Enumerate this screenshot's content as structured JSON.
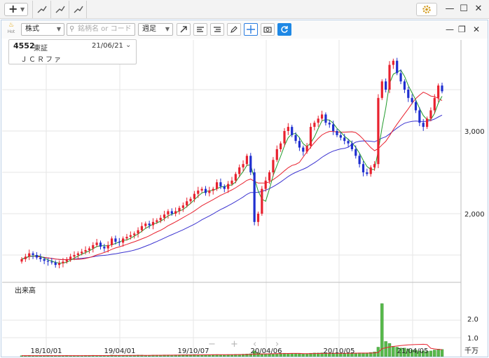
{
  "panel": {
    "market_select": "株式",
    "search_placeholder": "銘柄名 or コード",
    "period_select": "週足"
  },
  "info": {
    "code": "4552",
    "market": "東証",
    "date": "21/06/21",
    "name": "ＪＣＲファ"
  },
  "chart_data": {
    "type": "candlestick",
    "subtype": "weekly",
    "y_ticks": [
      "3,000",
      "2,000"
    ],
    "y_tick_values": [
      3000,
      2000
    ],
    "x_ticks": [
      "18/10/01",
      "19/04/01",
      "19/10/07",
      "20/04/06",
      "20/10/05",
      "21/04/05"
    ],
    "volume_label": "出来高",
    "volume_ticks": [
      "2.0",
      "1.0"
    ],
    "volume_tick_values": [
      2.0,
      1.0
    ],
    "volume_unit": "千万",
    "colors": {
      "up": "#e8212e",
      "down": "#1f2fd0",
      "ma_short": "#1f9a2a",
      "ma_mid": "#e8212e",
      "ma_long": "#3a32d0",
      "volume": "#57b94b"
    },
    "closes": [
      1450,
      1480,
      1520,
      1500,
      1470,
      1450,
      1430,
      1420,
      1410,
      1380,
      1400,
      1420,
      1450,
      1480,
      1500,
      1520,
      1540,
      1560,
      1580,
      1620,
      1650,
      1600,
      1580,
      1620,
      1700,
      1660,
      1650,
      1700,
      1720,
      1740,
      1760,
      1800,
      1850,
      1880,
      1860,
      1900,
      1920,
      1950,
      1990,
      2030,
      2000,
      2030,
      2070,
      2100,
      2150,
      2180,
      2240,
      2280,
      2300,
      2250,
      2280,
      2300,
      2380,
      2330,
      2300,
      2360,
      2400,
      2480,
      2560,
      2600,
      2700,
      2500,
      1900,
      2000,
      2300,
      2400,
      2500,
      2650,
      2780,
      2850,
      3000,
      3050,
      2950,
      2880,
      2800,
      2750,
      2820,
      3050,
      3100,
      3150,
      3200,
      3100,
      3080,
      3000,
      2950,
      2920,
      2880,
      2850,
      2780,
      2700,
      2600,
      2500,
      2480,
      2560,
      2600,
      3400,
      3600,
      3500,
      3800,
      3850,
      3700,
      3600,
      3500,
      3400,
      3350,
      3250,
      3100,
      3050,
      3150,
      3250,
      3400,
      3550,
      3480
    ],
    "volumes": [
      0.05,
      0.05,
      0.06,
      0.05,
      0.05,
      0.05,
      0.05,
      0.06,
      0.05,
      0.05,
      0.05,
      0.05,
      0.06,
      0.05,
      0.05,
      0.05,
      0.05,
      0.06,
      0.06,
      0.07,
      0.06,
      0.05,
      0.05,
      0.06,
      0.08,
      0.07,
      0.06,
      0.07,
      0.06,
      0.06,
      0.07,
      0.08,
      0.08,
      0.07,
      0.07,
      0.08,
      0.08,
      0.08,
      0.09,
      0.09,
      0.08,
      0.09,
      0.09,
      0.1,
      0.1,
      0.1,
      0.11,
      0.1,
      0.1,
      0.1,
      0.1,
      0.11,
      0.11,
      0.1,
      0.1,
      0.11,
      0.11,
      0.12,
      0.12,
      0.13,
      0.14,
      0.15,
      0.3,
      0.2,
      0.15,
      0.14,
      0.14,
      0.15,
      0.16,
      0.17,
      0.18,
      0.17,
      0.16,
      0.16,
      0.15,
      0.15,
      0.16,
      0.18,
      0.19,
      0.19,
      0.2,
      0.19,
      0.18,
      0.18,
      0.17,
      0.17,
      0.18,
      0.18,
      0.18,
      0.19,
      0.2,
      0.2,
      0.2,
      0.22,
      0.25,
      0.5,
      2.8,
      0.8,
      0.7,
      0.55,
      0.5,
      0.45,
      0.45,
      0.4,
      0.35,
      0.35,
      0.3,
      0.3,
      0.28,
      0.3,
      0.35,
      0.4,
      0.38
    ]
  }
}
